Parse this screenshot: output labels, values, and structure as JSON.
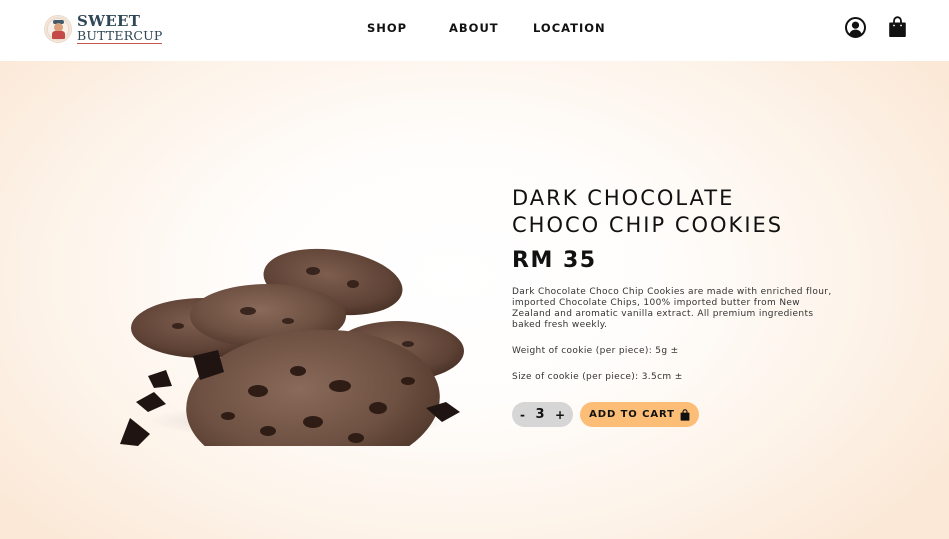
{
  "brand": {
    "name_line1": "SWEET",
    "name_line2": "BUTTERCUP"
  },
  "nav": {
    "items": [
      {
        "label": "SHOP"
      },
      {
        "label": "ABOUT"
      },
      {
        "label": "LOCATION"
      }
    ]
  },
  "header_icons": {
    "account": "account-icon",
    "cart": "shopping-bag-icon"
  },
  "product": {
    "title_line1": "DARK CHOCOLATE",
    "title_line2": "CHOCO CHIP COOKIES",
    "price": "RM 35",
    "description": "Dark Chocolate Choco Chip Cookies are made with enriched flour, imported Chocolate Chips, 100% imported butter from New Zealand and aromatic vanilla extract. All premium ingredients baked fresh weekly.",
    "weight": "Weight of cookie (per piece): 5g ±",
    "size": "Size of cookie (per piece): 3.5cm ±",
    "image": "chocolate-chip-cookies-image"
  },
  "quantity": {
    "decrement_label": "-",
    "value": "3",
    "increment_label": "+"
  },
  "add_to_cart": {
    "label": "ADD TO CART",
    "icon": "shopping-bag-icon"
  },
  "colors": {
    "accent": "#fcbd77",
    "brand_text": "#2f4756",
    "brand_underline": "#c9564e",
    "hero_edge": "#fbe8d6",
    "quantity_bg": "#d6d6d6"
  }
}
